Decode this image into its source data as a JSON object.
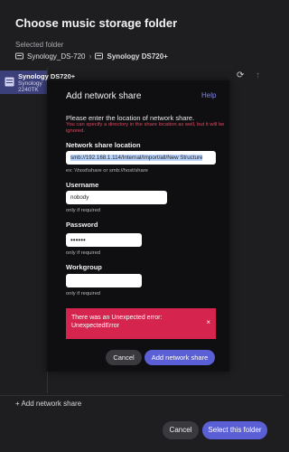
{
  "window": {
    "title": "Choose music storage folder",
    "selected_label": "Selected folder",
    "breadcrumb": [
      "Synology_DS-720",
      "Synology DS720+"
    ]
  },
  "sidebar": {
    "device": {
      "name": "Synology DS720+",
      "line2": "Synology",
      "line3": "2240TK"
    },
    "add_share_label": "Add network share"
  },
  "toolbar": {
    "refresh_icon": "refresh-icon",
    "up_icon": "up-arrow-icon"
  },
  "footer": {
    "cancel_label": "Cancel",
    "select_label": "Select this folder"
  },
  "modal": {
    "title": "Add network share",
    "help_label": "Help",
    "prompt": "Please enter the location of network share.",
    "note": "You can specify a directory in the share location as well, but it will be ignored.",
    "location": {
      "label": "Network share location",
      "value": "smb://192.168.1.114/Internal/Import/all/New Structure",
      "hint": "ex: \\\\host\\share or smb://host/share"
    },
    "username": {
      "label": "Username",
      "value": "nobody",
      "hint": "only if required"
    },
    "password": {
      "label": "Password",
      "value": "••••••",
      "hint": "only if required"
    },
    "workgroup": {
      "label": "Workgroup",
      "value": "",
      "hint": "only if required"
    },
    "error": {
      "line1": "There was an Unexpected error:",
      "line2": "UnexpectedError",
      "close": "×"
    },
    "cancel_label": "Cancel",
    "add_label": "Add network share"
  },
  "colors": {
    "accent": "#5b5fd6",
    "error": "#d5244d",
    "background": "#1e1e20",
    "modal_bg": "#0f0f11",
    "selected_item": "#3b3f7a"
  }
}
